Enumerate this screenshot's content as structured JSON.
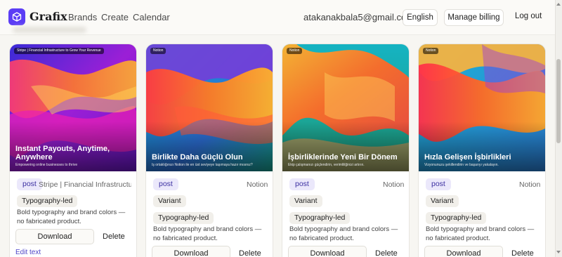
{
  "app": {
    "name": "Grafix",
    "nav": [
      "Brands",
      "Create",
      "Calendar"
    ],
    "email": "atakanakbala5@gmail.com",
    "language_label": "English",
    "billing_label": "Manage billing",
    "logout_label": "Log out"
  },
  "cards": [
    {
      "brand_chip": "Stripe | Financial Infrastructure to Grow Your Revenue",
      "title": "Instant Payouts, Anytime, Anywhere",
      "subtitle": "Empowering online businesses to thrive",
      "badge": "post",
      "brand": "Stripe | Financial Infrastructu…",
      "tag1": "Typography-led",
      "description": "Bold typography and brand colors — no fabricated product.",
      "download_label": "Download",
      "delete_label": "Delete",
      "edit_label": "Edit text"
    },
    {
      "brand_chip": "Notion",
      "title": "Birlikte Daha Güçlü Olun",
      "subtitle": "İş ortaklığınızı Notion ile en üst seviyeye taşımaya hazır mısınız?",
      "badge": "post",
      "brand": "Notion",
      "tag1": "Variant",
      "tag2": "Typography-led",
      "description": "Bold typography and brand colors — no fabricated product.",
      "download_label": "Download",
      "delete_label": "Delete"
    },
    {
      "brand_chip": "Notion",
      "title": "İşbirliklerinde Yeni Bir Dönem",
      "subtitle": "Ekip çalışmanızı güçlendirin, verimliliğinizi artırın.",
      "badge": "post",
      "brand": "Notion",
      "tag1": "Variant",
      "tag2": "Typography-led",
      "description": "Bold typography and brand colors — no fabricated product.",
      "download_label": "Download",
      "delete_label": "Delete"
    },
    {
      "brand_chip": "Notion",
      "title": "Hızla Gelişen İşbirlikleri",
      "subtitle": "Vizyonunuzu şekillendirin ve başarıyı yakalayın.",
      "badge": "post",
      "brand": "Notion",
      "tag1": "Variant",
      "tag2": "Typography-led",
      "description": "Bold typography and brand colors — no fabricated product.",
      "download_label": "Download",
      "delete_label": "Delete"
    }
  ]
}
